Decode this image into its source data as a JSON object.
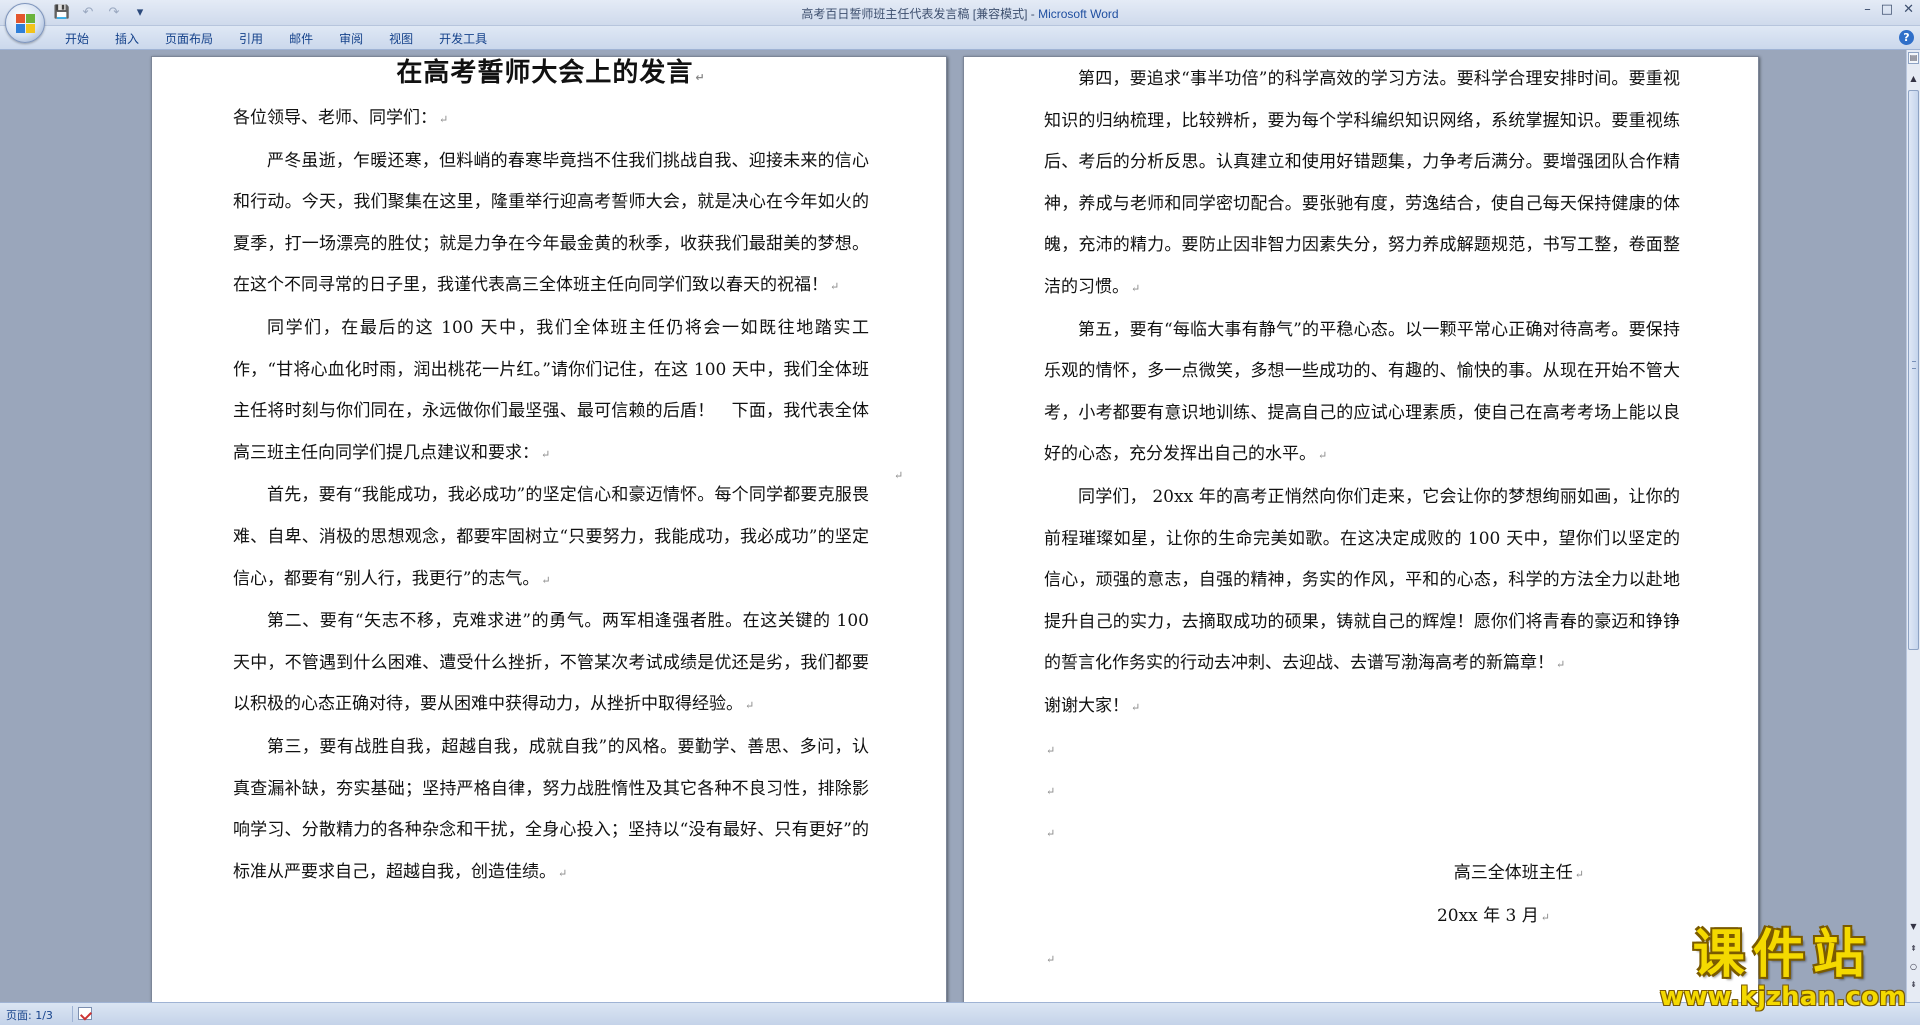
{
  "window": {
    "title": "高考百日誓师班主任代表发言稿 [兼容模式] - ",
    "app_name": "Microsoft Word",
    "controls": [
      "–",
      "□",
      "✕"
    ]
  },
  "qat": {
    "save_icon": "💾",
    "undo_icon": "↶",
    "redo_icon": "↷",
    "customize_icon": "▾"
  },
  "ribbon": {
    "tabs": [
      "开始",
      "插入",
      "页面布局",
      "引用",
      "邮件",
      "审阅",
      "视图",
      "开发工具"
    ],
    "help": "?"
  },
  "document": {
    "title": "在高考誓师大会上的发言",
    "left_paragraphs": [
      {
        "text": "各位领导、老师、同学们：",
        "indent": false
      },
      {
        "text": "严冬虽逝，乍暖还寒，但料峭的春寒毕竟挡不住我们挑战自我、迎接未来的信心和行动。今天，我们聚集在这里，隆重举行迎高考誓师大会，就是决心在今年如火的夏季，打一场漂亮的胜仗；就是力争在今年最金黄的秋季，收获我们最甜美的梦想。在这个不同寻常的日子里，我谨代表高三全体班主任向同学们致以春天的祝福！",
        "indent": true
      },
      {
        "text": "同学们，在最后的这 100 天中，我们全体班主任仍将会一如既往地踏实工作，“甘将心血化时雨，润出桃花一片红。”请你们记住，在这 100 天中，我们全体班主任将时刻与你们同在，永远做你们最坚强、最可信赖的后盾！　下面，我代表全体高三班主任向同学们提几点建议和要求：",
        "indent": true
      },
      {
        "text": "首先，要有“我能成功，我必成功”的坚定信心和豪迈情怀。每个同学都要克服畏难、自卑、消极的思想观念，都要牢固树立“只要努力，我能成功，我必成功”的坚定信心，都要有“别人行，我更行”的志气。",
        "indent": true
      },
      {
        "text": "第二、要有“矢志不移，克难求进”的勇气。两军相逢强者胜。在这关键的 100 天中，不管遇到什么困难、遭受什么挫折，不管某次考试成绩是优还是劣，我们都要以积极的心态正确对待，要从困难中获得动力，从挫折中取得经验。",
        "indent": true
      },
      {
        "text": "第三，要有战胜自我，超越自我，成就自我”的风格。要勤学、善思、多问，认真查漏补缺，夯实基础；坚持严格自律，努力战胜惰性及其它各种不良习性，排除影响学习、分散精力的各种杂念和干扰，全身心投入；坚持以“没有最好、只有更好”的标准从严要求自己，超越自我，创造佳绩。",
        "indent": true
      }
    ],
    "right_paragraphs": [
      {
        "text": "第四，要追求“事半功倍”的科学高效的学习方法。要科学合理安排时间。要重视知识的归纳梳理，比较辨析，要为每个学科编织知识网络，系统掌握知识。要重视练后、考后的分析反思。认真建立和使用好错题集，力争考后满分。要增强团队合作精神，养成与老师和同学密切配合。要张驰有度，劳逸结合，使自己每天保持健康的体魄，充沛的精力。要防止因非智力因素失分，努力养成解题规范，书写工整，卷面整洁的习惯。",
        "indent": true
      },
      {
        "text": "第五，要有“每临大事有静气”的平稳心态。以一颗平常心正确对待高考。要保持乐观的情怀，多一点微笑，多想一些成功的、有趣的、愉快的事。从现在开始不管大考，小考都要有意识地训练、提高自己的应试心理素质，使自己在高考考场上能以良好的心态，充分发挥出自己的水平。",
        "indent": true
      },
      {
        "text": "同学们， 20xx 年的高考正悄然向你们走来，它会让你的梦想绚丽如画，让你的前程璀璨如星，让你的生命完美如歌。在这决定成败的 100 天中，望你们以坚定的信心，顽强的意志，自强的精神，务实的作风，平和的心态，科学的方法全力以赴地提升自己的实力，去摘取成功的硕果，铸就自己的辉煌！愿你们将青春的豪迈和铮铮的誓言化作务实的行动去冲刺、去迎战、去谱写渤海高考的新篇章！",
        "indent": true
      },
      {
        "text": "谢谢大家！",
        "indent": false
      }
    ],
    "signature": "高三全体班主任",
    "date": "20xx 年 3 月"
  },
  "status": {
    "page": "页面: 1/3"
  },
  "watermark": {
    "main": "课件站",
    "sub": "www.kjzhan.com"
  }
}
